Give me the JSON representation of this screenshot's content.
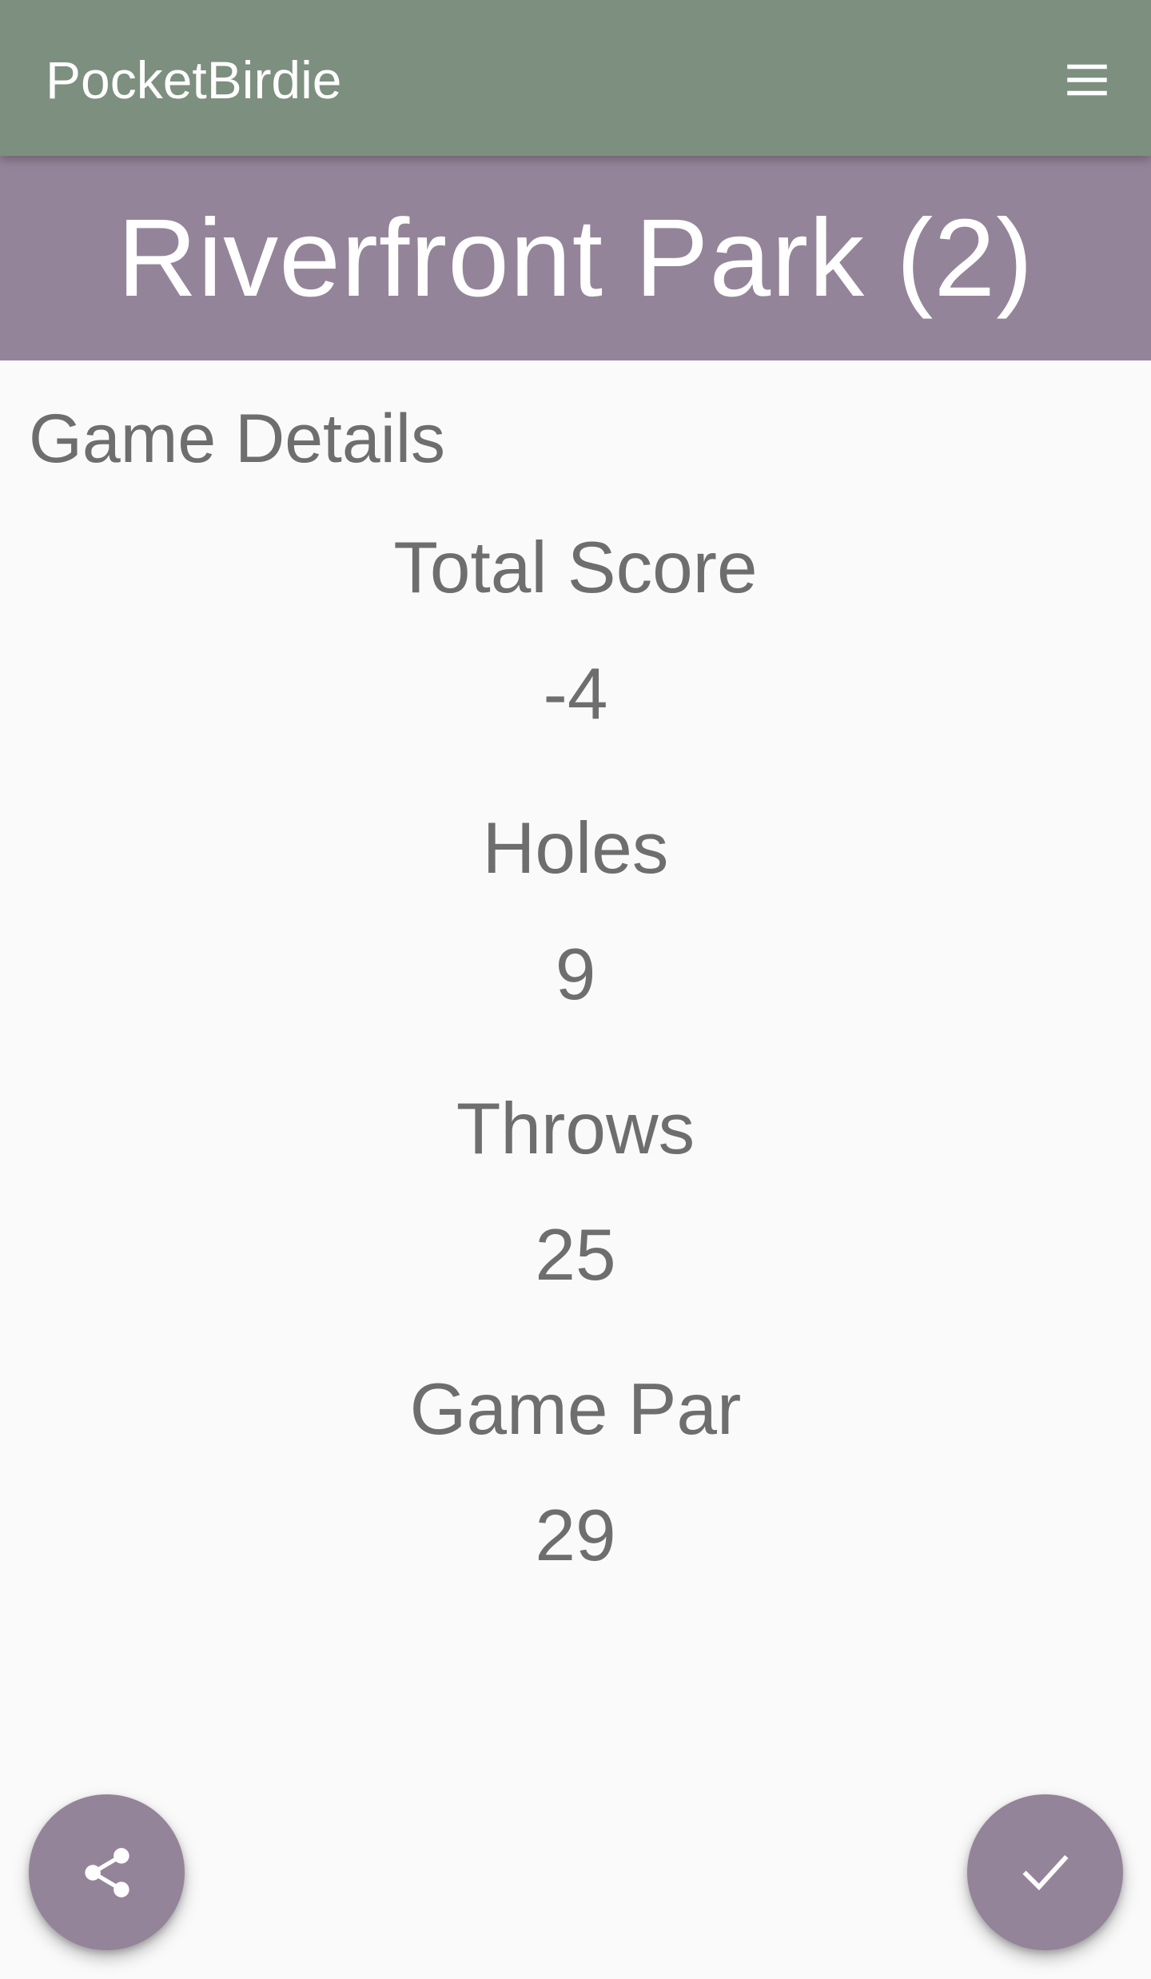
{
  "app": {
    "title": "PocketBirdie",
    "menu_icon": "menu-icon",
    "colors": {
      "appbar": "#7d8f7f",
      "accent": "#948499",
      "text": "#6e6e6e",
      "background": "#fafafa"
    }
  },
  "course": {
    "title": "Riverfront Park (2)"
  },
  "details": {
    "heading": "Game Details",
    "stats": [
      {
        "label": "Total Score",
        "value": "-4"
      },
      {
        "label": "Holes",
        "value": "9"
      },
      {
        "label": "Throws",
        "value": "25"
      },
      {
        "label": "Game Par",
        "value": "29"
      }
    ]
  },
  "actions": {
    "share_icon": "share-icon",
    "done_icon": "checkmark-icon"
  }
}
